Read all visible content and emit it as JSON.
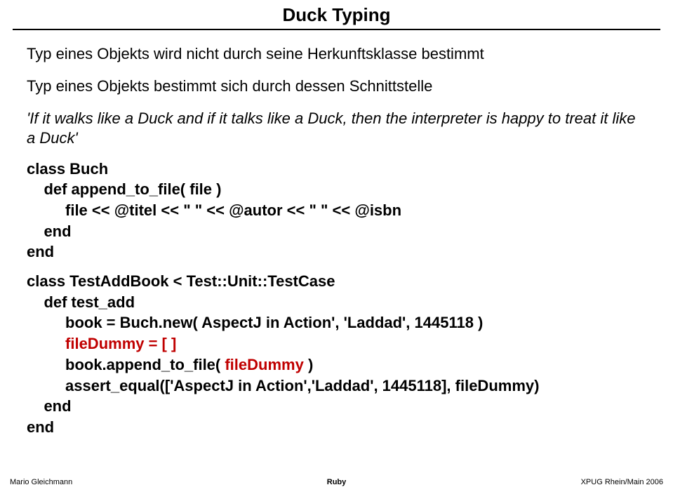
{
  "title": "Duck Typing",
  "para1": "Typ eines Objekts wird nicht durch seine Herkunftsklasse bestimmt",
  "para2": "Typ eines Objekts bestimmt sich durch dessen Schnittstelle",
  "quote": "'If it walks like a Duck and if it talks like a Duck, then the interpreter is happy to treat it like a Duck'",
  "code_block1": {
    "l1": "class Buch",
    "l2": "    def append_to_file( file )",
    "l3": "         file << @titel << \" \" << @autor << \" \" << @isbn",
    "l4": "    end",
    "l5": "end"
  },
  "code_block2": {
    "l1": "class TestAddBook < Test::Unit::TestCase",
    "l2": "    def test_add",
    "l3a": "         book = Buch.new( AspectJ in Action', 'Laddad', 1445118 )",
    "l4a": "         ",
    "l4b": "fileDummy = [ ]",
    "l5a": "         book.append_to_file( ",
    "l5b": "fileDummy",
    "l5c": " )",
    "l6": "         assert_equal(['AspectJ in Action','Laddad', 1445118], fileDummy)",
    "l7": "    end",
    "l8": "end"
  },
  "footer": {
    "left": "Mario Gleichmann",
    "mid": "Ruby",
    "right": "XPUG Rhein/Main 2006"
  }
}
